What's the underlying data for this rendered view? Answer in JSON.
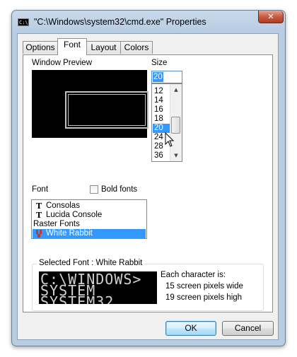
{
  "window": {
    "title": "\"C:\\Windows\\system32\\cmd.exe\" Properties",
    "app_icon_text": "C:\\",
    "close_label": "✕"
  },
  "tabs": [
    {
      "label": "Options",
      "active": false
    },
    {
      "label": "Font",
      "active": true
    },
    {
      "label": "Layout",
      "active": false
    },
    {
      "label": "Colors",
      "active": false
    }
  ],
  "preview": {
    "label": "Window Preview"
  },
  "size": {
    "label": "Size",
    "value": "20",
    "options": [
      "12",
      "14",
      "16",
      "18",
      "20",
      "24",
      "28",
      "36"
    ],
    "selected": "20"
  },
  "font": {
    "label": "Font",
    "bold_label": "Bold fonts",
    "bold_checked": false,
    "items": [
      {
        "label": "Consolas",
        "icon": "truetype-icon"
      },
      {
        "label": "Lucida Console",
        "icon": "truetype-icon"
      },
      {
        "label": "Raster Fonts",
        "icon": "none"
      },
      {
        "label": "White Rabbit",
        "icon": "raster-font-icon",
        "selected": true
      }
    ]
  },
  "selected_font": {
    "legend": "Selected Font : White Rabbit",
    "sample_lines": [
      "C:\\WINDOWS>",
      "SYSTEM",
      "SYSTEM32"
    ],
    "each_char_label": "Each character is:",
    "width_text": "15 screen pixels wide",
    "height_text": "19 screen pixels high"
  },
  "buttons": {
    "ok": "OK",
    "cancel": "Cancel"
  },
  "colors": {
    "selection": "#3399ff",
    "close_button": "#c85b43",
    "titlebar": "#b8cde3"
  }
}
